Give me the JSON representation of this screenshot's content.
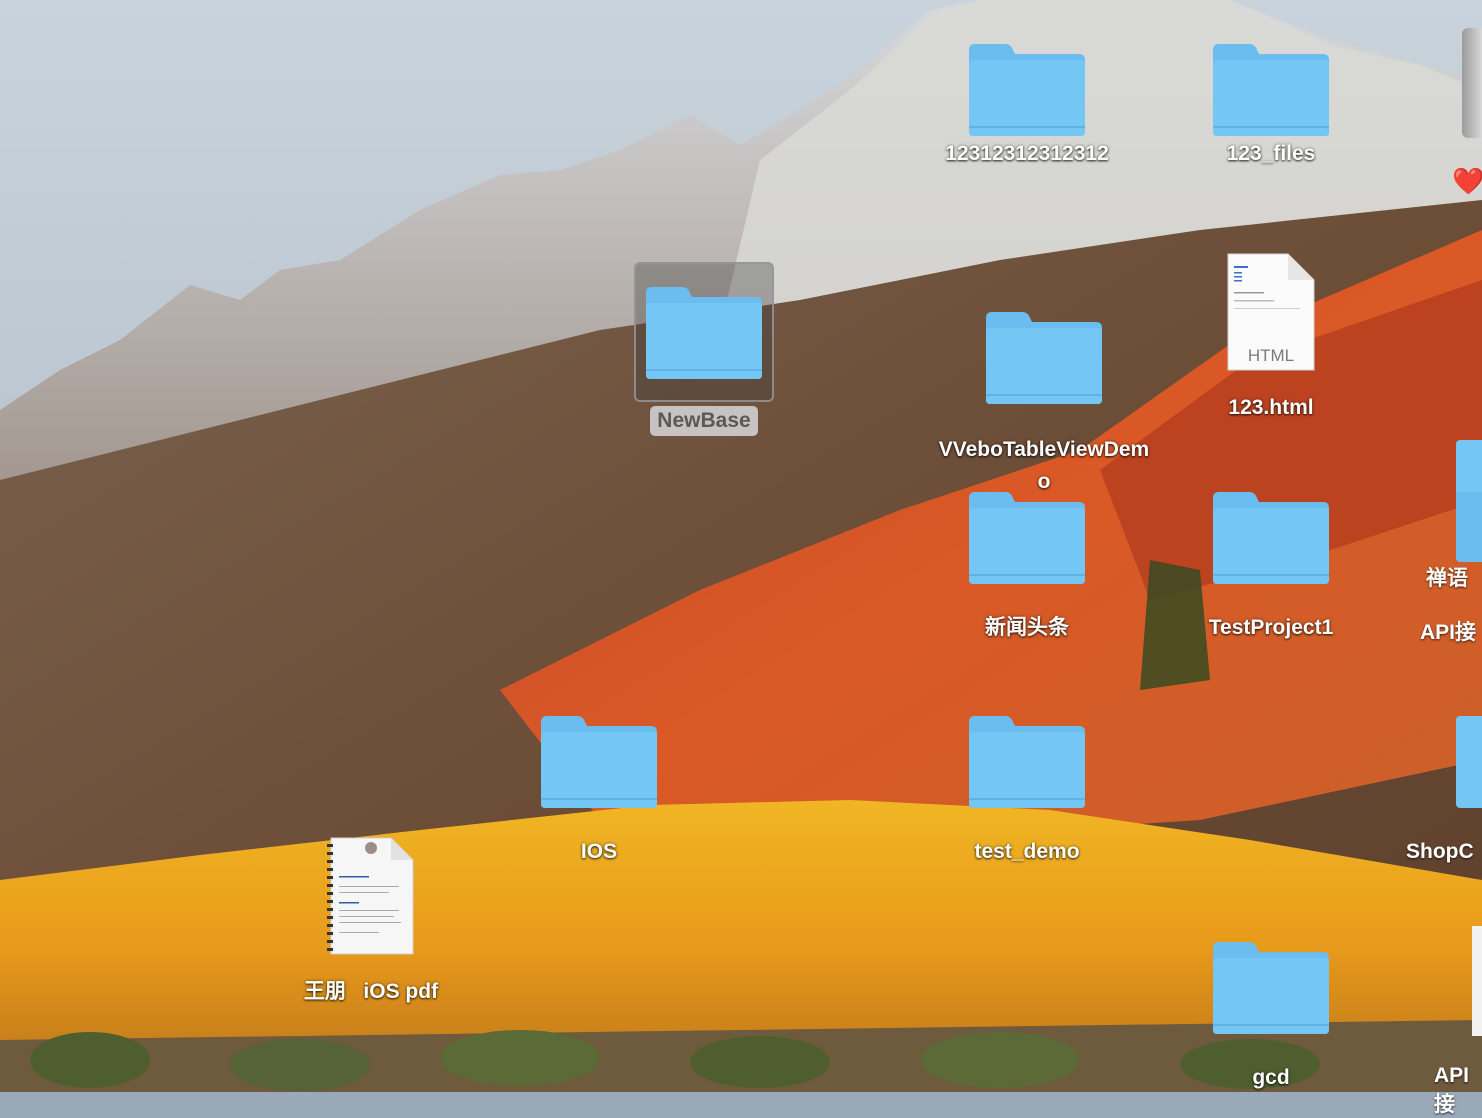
{
  "desktop": {
    "icons": {
      "folder_1231": {
        "label": "12312312312312",
        "icon": "folder-icon"
      },
      "folder_123_files": {
        "label": "123_files",
        "icon": "folder-icon"
      },
      "folder_newbase": {
        "label": "NewBase",
        "icon": "folder-icon",
        "selected": true
      },
      "folder_vvebo": {
        "label": "VVeboTableViewDemo",
        "icon": "folder-icon"
      },
      "file_123_html": {
        "label": "123.html",
        "icon": "html-document-icon",
        "badge": "HTML"
      },
      "folder_news": {
        "label": "新闻头条",
        "icon": "folder-icon"
      },
      "folder_testproject1": {
        "label": "TestProject1",
        "icon": "folder-icon"
      },
      "folder_ios": {
        "label": "IOS",
        "icon": "folder-icon"
      },
      "folder_test_demo": {
        "label": "test_demo",
        "icon": "folder-icon"
      },
      "file_pdf": {
        "label": "王朋   iOS pdf",
        "icon": "pdf-document-icon"
      },
      "folder_gcd": {
        "label": "gcd",
        "icon": "folder-icon"
      },
      "partial_chan": {
        "label": "禅语",
        "icon": "folder-icon"
      },
      "partial_api1": {
        "label": "API接",
        "icon": "folder-icon"
      },
      "partial_shop": {
        "label": "ShopC",
        "icon": "folder-icon"
      },
      "partial_api2": {
        "label": "API接",
        "icon": "document-icon"
      }
    },
    "heart": {
      "glyph": "❤️"
    }
  },
  "colors": {
    "folder_body": "#74c7f5",
    "folder_tab": "#6bbdf0",
    "label_text": "#ffffff"
  }
}
